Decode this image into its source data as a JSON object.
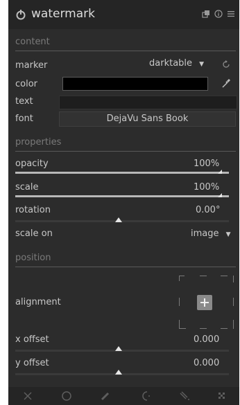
{
  "header": {
    "title": "watermark",
    "icons": [
      "power-icon",
      "presets-icon",
      "reset-icon",
      "menu-icon"
    ]
  },
  "sections": {
    "content": "content",
    "properties": "properties",
    "position": "position"
  },
  "content": {
    "marker_label": "marker",
    "marker_value": "darktable",
    "color_label": "color",
    "color_value": "#000000",
    "text_label": "text",
    "text_value": "",
    "font_label": "font",
    "font_value": "DejaVu Sans Book"
  },
  "properties": {
    "opacity_label": "opacity",
    "opacity_value": "100%",
    "opacity_fraction": 1.0,
    "scale_label": "scale",
    "scale_value": "100%",
    "scale_fraction": 1.0,
    "rotation_label": "rotation",
    "rotation_value": "0.00°",
    "scale_on_label": "scale on",
    "scale_on_value": "image"
  },
  "position": {
    "alignment_label": "alignment",
    "x_offset_label": "x offset",
    "x_offset_value": "0.000",
    "y_offset_label": "y offset",
    "y_offset_value": "0.000"
  },
  "bottom_icons": [
    "off-icon",
    "circle-icon",
    "brush-icon",
    "drawn-parametric-icon",
    "parametric-icon",
    "raster-icon"
  ],
  "colors": {
    "panel_bg": "#2c2c2c",
    "header_bg": "#252525",
    "text": "#c8c8c8",
    "section_text": "#7a7a7a"
  }
}
